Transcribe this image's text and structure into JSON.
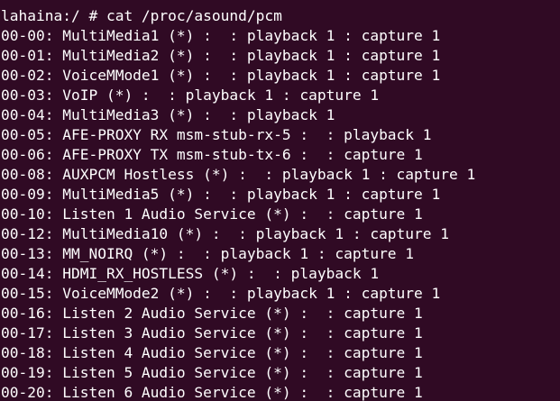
{
  "terminal": {
    "top_cutoff_text": "                                 ",
    "prompt": "lahaina:/ # cat /proc/asound/pcm",
    "lines": [
      "00-00: MultiMedia1 (*) :  : playback 1 : capture 1",
      "00-01: MultiMedia2 (*) :  : playback 1 : capture 1",
      "00-02: VoiceMMode1 (*) :  : playback 1 : capture 1",
      "00-03: VoIP (*) :  : playback 1 : capture 1",
      "00-04: MultiMedia3 (*) :  : playback 1",
      "00-05: AFE-PROXY RX msm-stub-rx-5 :  : playback 1",
      "00-06: AFE-PROXY TX msm-stub-tx-6 :  : capture 1",
      "00-08: AUXPCM Hostless (*) :  : playback 1 : capture 1",
      "00-09: MultiMedia5 (*) :  : playback 1 : capture 1",
      "00-10: Listen 1 Audio Service (*) :  : capture 1",
      "00-12: MultiMedia10 (*) :  : playback 1 : capture 1",
      "00-13: MM_NOIRQ (*) :  : playback 1 : capture 1",
      "00-14: HDMI_RX_HOSTLESS (*) :  : playback 1",
      "00-15: VoiceMMode2 (*) :  : playback 1 : capture 1",
      "00-16: Listen 2 Audio Service (*) :  : capture 1",
      "00-17: Listen 3 Audio Service (*) :  : capture 1",
      "00-18: Listen 4 Audio Service (*) :  : capture 1",
      "00-19: Listen 5 Audio Service (*) :  : capture 1",
      "00-20: Listen 6 Audio Service (*) :  : capture 1"
    ]
  },
  "colors": {
    "background": "#300a24",
    "text": "#ffffff"
  }
}
